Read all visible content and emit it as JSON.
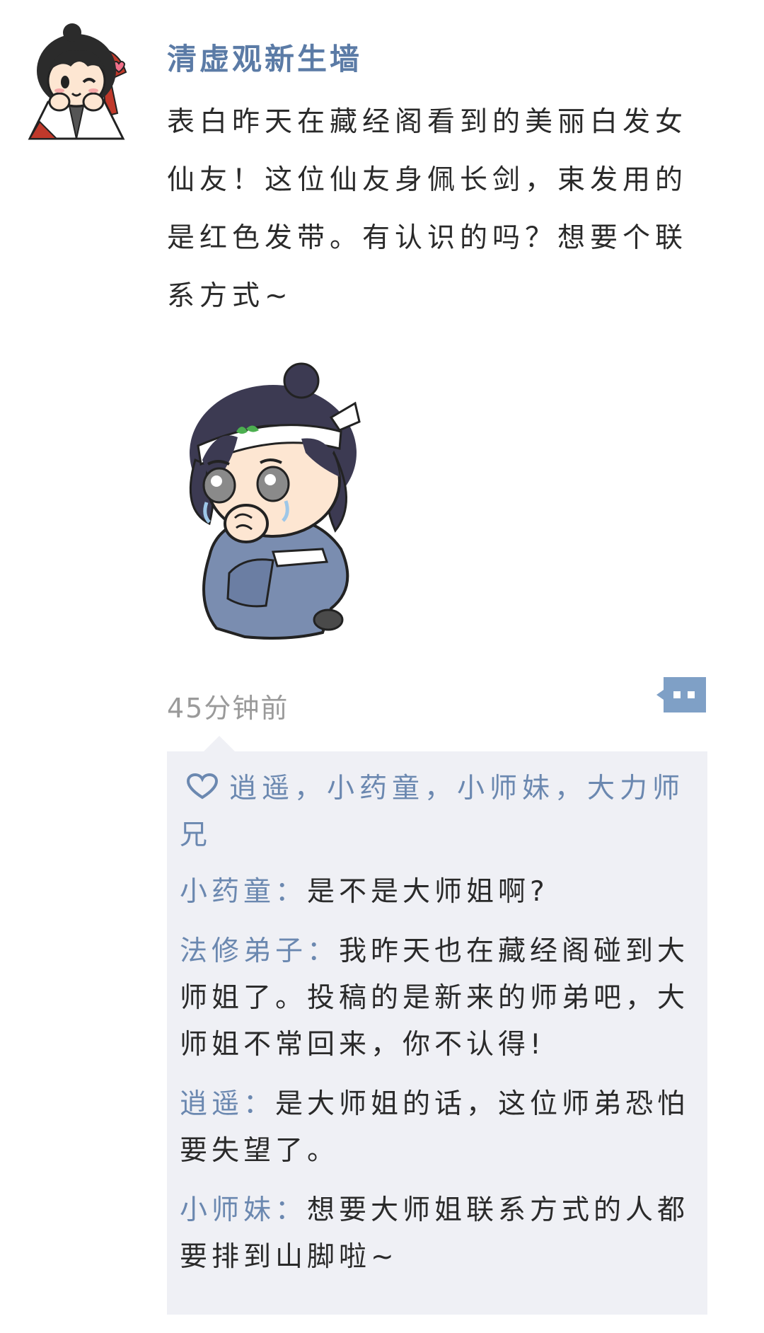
{
  "post": {
    "username": "清虚观新生墙",
    "content": "表白昨天在藏经阁看到的美丽白发女仙友！这位仙友身佩长剑，束发用的是红色发带。有认识的吗？想要个联系方式~",
    "timestamp": "45分钟前"
  },
  "likes": {
    "icon": "heart-icon",
    "names": "逍遥，小药童，小师妹，大力师兄"
  },
  "comments": [
    {
      "author": "小药童：",
      "text": "是不是大师姐啊?"
    },
    {
      "author": "法修弟子：",
      "text": "我昨天也在藏经阁碰到大师姐了。投稿的是新来的师弟吧，大师姐不常回来，你不认得!"
    },
    {
      "author": "逍遥：",
      "text": "是大师姐的话，这位师弟恐怕要失望了。"
    },
    {
      "author": "小师妹：",
      "text": "想要大师姐联系方式的人都要排到山脚啦~"
    }
  ],
  "colors": {
    "name_blue": "#5b7ba6",
    "link_blue": "#6b88b0",
    "panel_bg": "#eff0f5",
    "timestamp_gray": "#9a9a9a"
  }
}
